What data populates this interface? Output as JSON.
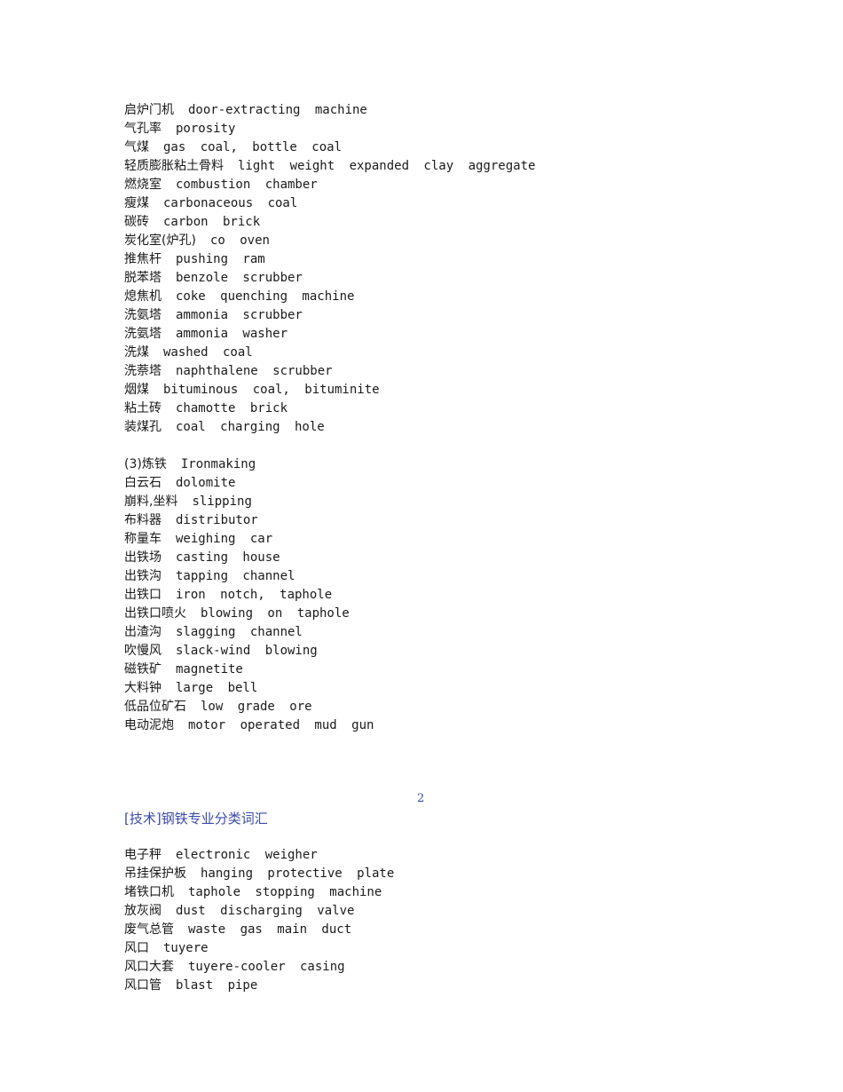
{
  "page1": {
    "entries": [
      {
        "zh": "启炉门机",
        "en": "door-extracting machine"
      },
      {
        "zh": "气孔率",
        "en": "porosity"
      },
      {
        "zh": "气煤",
        "en": "gas coal, bottle coal"
      },
      {
        "zh": "轻质膨胀粘土骨料",
        "en": "light weight expanded clay aggregate"
      },
      {
        "zh": "燃烧室",
        "en": "combustion chamber"
      },
      {
        "zh": "瘦煤",
        "en": "carbonaceous coal"
      },
      {
        "zh": "碳砖",
        "en": "carbon brick"
      },
      {
        "zh": "炭化室(炉孔)",
        "en": "co oven"
      },
      {
        "zh": "推焦杆",
        "en": "pushing ram"
      },
      {
        "zh": "脱苯塔",
        "en": "benzole scrubber"
      },
      {
        "zh": "熄焦机",
        "en": "coke quenching machine"
      },
      {
        "zh": "洗氨塔",
        "en": "ammonia scrubber"
      },
      {
        "zh": "洗氨塔",
        "en": "ammonia washer"
      },
      {
        "zh": "洗煤",
        "en": "washed coal"
      },
      {
        "zh": "洗萘塔",
        "en": "naphthalene scrubber"
      },
      {
        "zh": "烟煤",
        "en": "bituminous coal, bituminite"
      },
      {
        "zh": "粘土砖",
        "en": "chamotte brick"
      },
      {
        "zh": "装煤孔",
        "en": "coal charging hole"
      }
    ],
    "section": {
      "zh": "(3)炼铁",
      "en": "Ironmaking"
    },
    "section_entries": [
      {
        "zh": "白云石",
        "en": "dolomite"
      },
      {
        "zh": "崩料,坐料",
        "en": "slipping"
      },
      {
        "zh": "布料器",
        "en": "distributor"
      },
      {
        "zh": "称量车",
        "en": "weighing car"
      },
      {
        "zh": "出铁场",
        "en": "casting house"
      },
      {
        "zh": "出铁沟",
        "en": "tapping channel"
      },
      {
        "zh": "出铁口",
        "en": "iron notch, taphole"
      },
      {
        "zh": "出铁口喷火",
        "en": "blowing on taphole"
      },
      {
        "zh": "出渣沟",
        "en": "slagging channel"
      },
      {
        "zh": "吹慢风",
        "en": "slack-wind blowing"
      },
      {
        "zh": "磁铁矿",
        "en": "magnetite"
      },
      {
        "zh": "大料钟",
        "en": "large bell"
      },
      {
        "zh": "低品位矿石",
        "en": "low grade ore"
      },
      {
        "zh": "电动泥炮",
        "en": "motor operated mud gun"
      }
    ],
    "page_number": "2"
  },
  "page2": {
    "header": "[技术]钢铁专业分类词汇",
    "entries": [
      {
        "zh": "电子秤",
        "en": "electronic weigher"
      },
      {
        "zh": "吊挂保护板",
        "en": "hanging protective plate"
      },
      {
        "zh": "堵铁口机",
        "en": "taphole stopping machine"
      },
      {
        "zh": "放灰阀",
        "en": "dust discharging valve"
      },
      {
        "zh": "废气总管",
        "en": "waste gas main duct"
      },
      {
        "zh": "风口",
        "en": "tuyere"
      },
      {
        "zh": "风口大套",
        "en": "tuyere-cooler casing"
      },
      {
        "zh": "风口管",
        "en": "blast pipe"
      }
    ]
  }
}
